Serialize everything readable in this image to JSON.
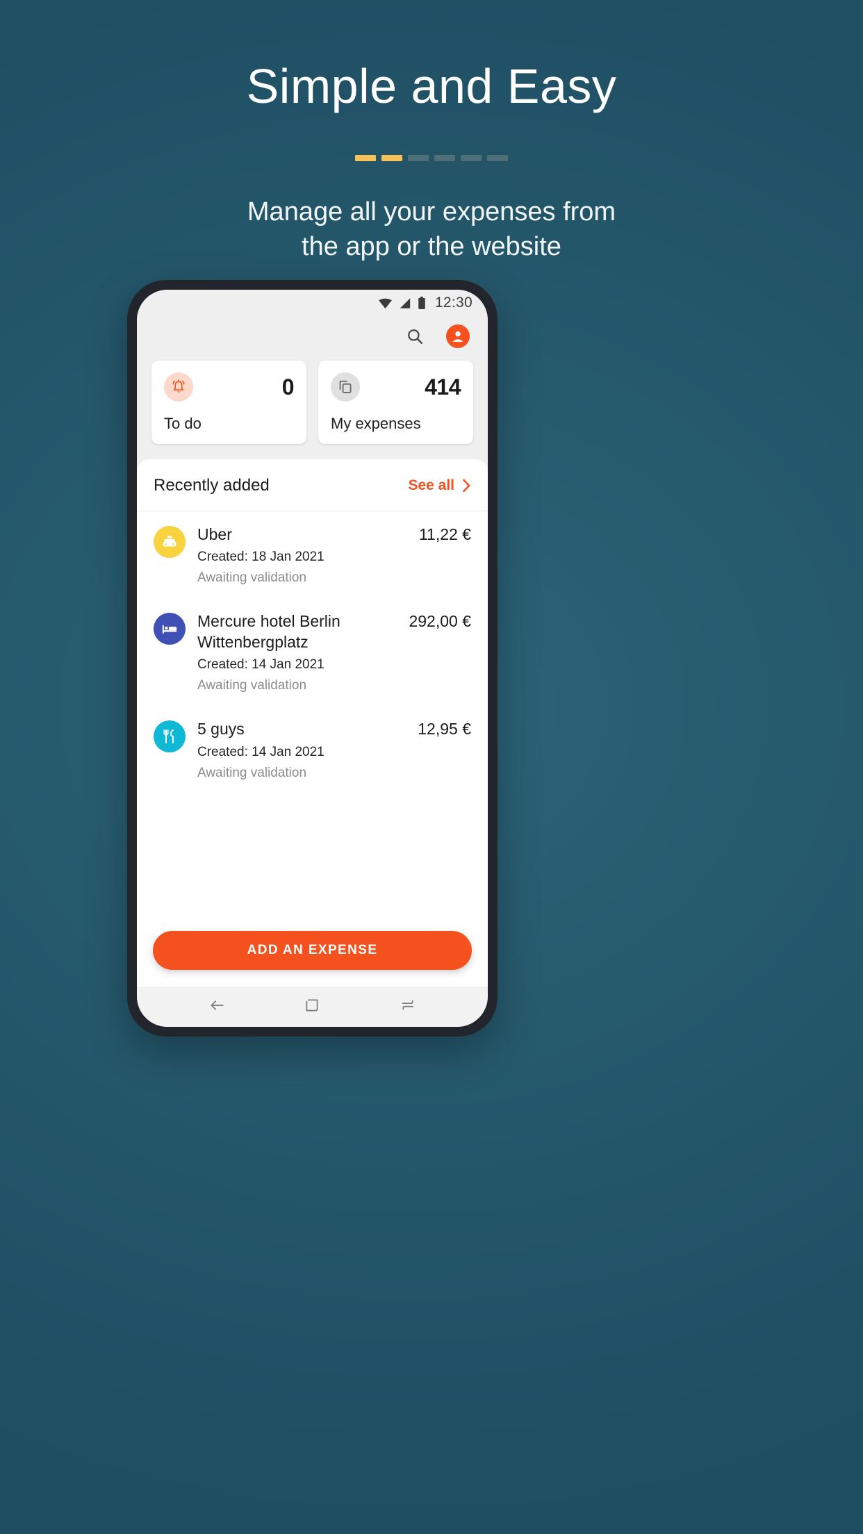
{
  "promo": {
    "title": "Simple and Easy",
    "subtitle_line1": "Manage all your expenses from",
    "subtitle_line2": "the app or the website",
    "dots": [
      {
        "state": "active"
      },
      {
        "state": "active"
      },
      {
        "state": "inactive"
      },
      {
        "state": "inactive"
      },
      {
        "state": "inactive"
      },
      {
        "state": "inactive"
      }
    ],
    "accent_active": "#f5c15a",
    "accent_inactive": "#4e6e78",
    "background": "#265a6d"
  },
  "phone": {
    "statusbar": {
      "wifi_icon": "wifi-icon",
      "signal_icon": "cellular-signal-icon",
      "battery_icon": "battery-icon",
      "time": "12:30"
    },
    "appbar": {
      "search_icon": "search-icon",
      "avatar_icon": "account-avatar-icon"
    },
    "stats": [
      {
        "icon": "bell-alert-icon",
        "value": "0",
        "label": "To do",
        "badge_color": "#fcd9ca",
        "icon_color": "#f4511e"
      },
      {
        "icon": "copy-stack-icon",
        "value": "414",
        "label": "My expenses",
        "badge_color": "#e0e0e0",
        "icon_color": "#707070"
      }
    ],
    "sheet": {
      "title": "Recently added",
      "see_all_label": "See all",
      "chevron_icon": "chevron-right-icon",
      "accent": "#f4511e",
      "items": [
        {
          "icon": "taxi-car-icon",
          "badge_color": "#f8d33f",
          "title": "Uber",
          "created": "Created: 18 Jan 2021",
          "status": "Awaiting validation",
          "amount": "11,22 €"
        },
        {
          "icon": "hotel-bed-icon",
          "badge_color": "#3f51b5",
          "title": "Mercure hotel Berlin Wittenbergplatz",
          "created": "Created: 14 Jan 2021",
          "status": "Awaiting validation",
          "amount": "292,00 €"
        },
        {
          "icon": "restaurant-cutlery-icon",
          "badge_color": "#0fb8d4",
          "title": "5 guys",
          "created": "Created: 14 Jan 2021",
          "status": "Awaiting validation",
          "amount": "12,95 €"
        }
      ]
    },
    "cta": {
      "label": "ADD AN EXPENSE",
      "color": "#f4511e"
    },
    "navbar": {
      "back_icon": "back-arrow-icon",
      "home_icon": "home-square-icon",
      "recents_icon": "recent-apps-icon"
    }
  }
}
